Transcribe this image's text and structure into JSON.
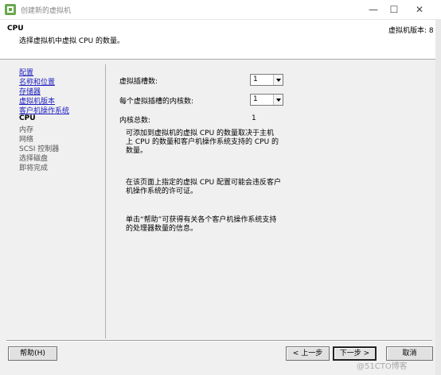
{
  "window": {
    "title": "创建新的虚拟机",
    "controls": {
      "minimize": "—",
      "maximize": "☐",
      "close": "✕"
    }
  },
  "header": {
    "title": "CPU",
    "subtitle": "选择虚拟机中虚拟 CPU 的数量。",
    "version": "虚拟机版本: 8"
  },
  "sidebar": {
    "items": [
      {
        "label": "配置",
        "state": "done"
      },
      {
        "label": "名称和位置",
        "state": "done"
      },
      {
        "label": "存储器",
        "state": "done"
      },
      {
        "label": "虚拟机版本",
        "state": "done"
      },
      {
        "label": "客户机操作系统",
        "state": "done"
      },
      {
        "label": "CPU",
        "state": "current"
      },
      {
        "label": "内存",
        "state": "pending"
      },
      {
        "label": "网络",
        "state": "pending"
      },
      {
        "label": "SCSI 控制器",
        "state": "pending"
      },
      {
        "label": "选择磁盘",
        "state": "pending"
      },
      {
        "label": "即将完成",
        "state": "pending"
      }
    ]
  },
  "main": {
    "sockets_label": "虚拟插槽数:",
    "sockets_value": "1",
    "cores_label": "每个虚拟插槽的内核数:",
    "cores_value": "1",
    "total_label": "内核总数:",
    "total_value": "1",
    "para1_line1": "可添加到虚拟机的虚拟 CPU 的数量取决于主机",
    "para1_line2": "上 CPU 的数量和客户机操作系统支持的 CPU 的",
    "para1_line3": "数量。",
    "para2_line1": "在该页面上指定的虚拟 CPU 配置可能会违反客户",
    "para2_line2": "机操作系统的许可证。",
    "para3_line1": "单击“帮助”可获得有关各个客户机操作系统支持",
    "para3_line2": "的处理器数量的信息。"
  },
  "footer": {
    "help_label": "帮助(H)",
    "back_label": "< 上一步",
    "next_label": "下一步 >",
    "cancel_label": "取消"
  },
  "watermark": "@51CTO博客",
  "colors": {
    "link": "#2020c0",
    "panel_bg": "#f0f0f0"
  },
  "icons": {
    "app": "vsphere-logo-icon",
    "dropdown": "chevron-down-icon"
  }
}
